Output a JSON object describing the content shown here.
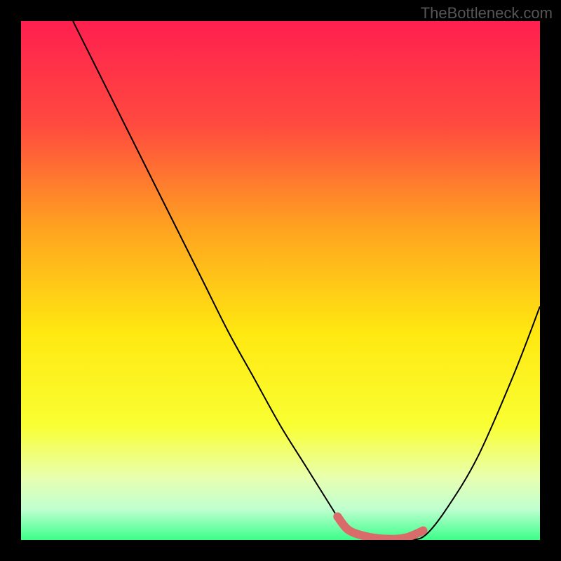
{
  "watermark": "TheBottleneck.com",
  "colors": {
    "bg": "#000000",
    "curve": "#000000",
    "highlight": "#d96b6b",
    "gradient_stops": [
      {
        "offset": 0,
        "color": "#ff1f4f"
      },
      {
        "offset": 0.2,
        "color": "#ff4a3f"
      },
      {
        "offset": 0.4,
        "color": "#ffa320"
      },
      {
        "offset": 0.6,
        "color": "#ffe810"
      },
      {
        "offset": 0.78,
        "color": "#f9ff33"
      },
      {
        "offset": 0.88,
        "color": "#e8ffb0"
      },
      {
        "offset": 0.94,
        "color": "#c0ffd0"
      },
      {
        "offset": 1.0,
        "color": "#3cff8a"
      }
    ]
  },
  "chart_data": {
    "type": "line",
    "title": "",
    "xlabel": "",
    "ylabel": "",
    "xlim": [
      0,
      100
    ],
    "ylim": [
      0,
      100
    ],
    "annotations": [],
    "series": [
      {
        "name": "bottleneck-curve",
        "x": [
          10,
          15,
          20,
          25,
          30,
          35,
          40,
          45,
          50,
          55,
          60,
          62,
          65,
          70,
          75,
          78,
          82,
          88,
          95,
          100
        ],
        "values": [
          100,
          90,
          80,
          70,
          60,
          50,
          40,
          31,
          22,
          14,
          6,
          3,
          1,
          0,
          0,
          1,
          6,
          16,
          32,
          45
        ]
      }
    ],
    "highlight": {
      "name": "optimal-range",
      "x": [
        61,
        63,
        66,
        70,
        74,
        77.5
      ],
      "values": [
        4.5,
        2.0,
        0.8,
        0.2,
        0.4,
        1.8
      ]
    }
  }
}
